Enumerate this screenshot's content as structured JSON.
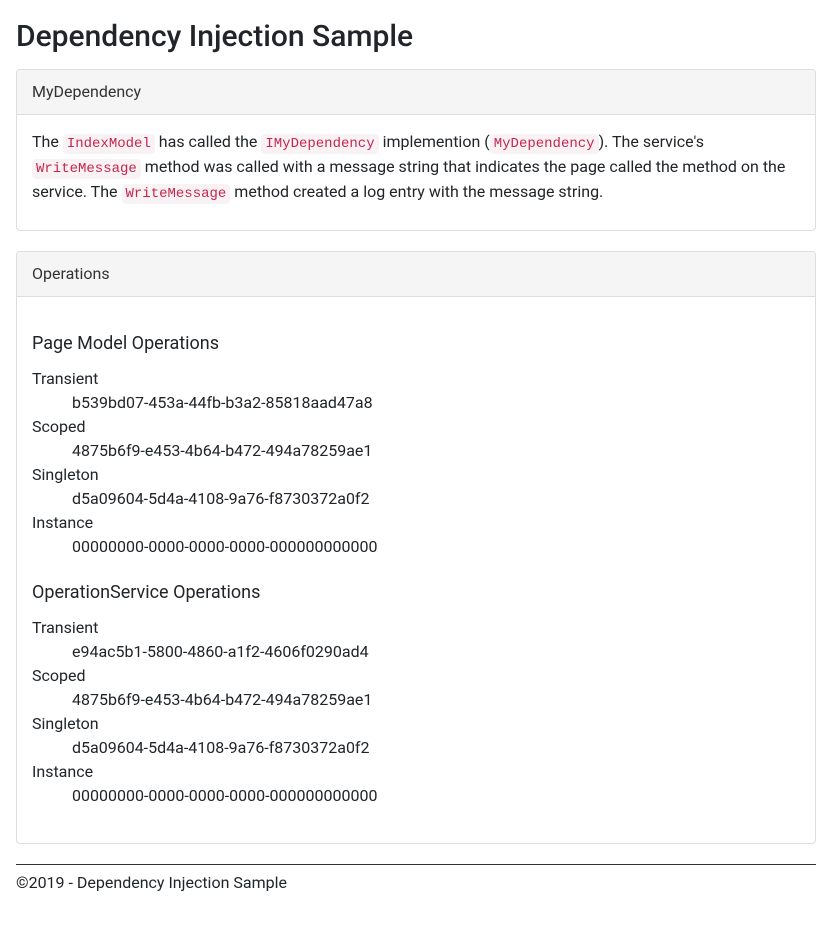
{
  "page_title": "Dependency Injection Sample",
  "panel1": {
    "heading": "MyDependency",
    "text_parts": {
      "t1": "The ",
      "c1": "IndexModel",
      "t2": " has called the ",
      "c2": "IMyDependency",
      "t3": " implemention (",
      "c3": "MyDependency",
      "t4": "). The service's ",
      "c4": "WriteMessage",
      "t5": " method was called with a message string that indicates the page called the method on the service. The ",
      "c5": "WriteMessage",
      "t6": " method created a log entry with the message string."
    }
  },
  "panel2": {
    "heading": "Operations",
    "page_model": {
      "title": "Page Model Operations",
      "labels": {
        "transient": "Transient",
        "scoped": "Scoped",
        "singleton": "Singleton",
        "instance": "Instance"
      },
      "values": {
        "transient": "b539bd07-453a-44fb-b3a2-85818aad47a8",
        "scoped": "4875b6f9-e453-4b64-b472-494a78259ae1",
        "singleton": "d5a09604-5d4a-4108-9a76-f8730372a0f2",
        "instance": "00000000-0000-0000-0000-000000000000"
      }
    },
    "operation_service": {
      "title": "OperationService Operations",
      "labels": {
        "transient": "Transient",
        "scoped": "Scoped",
        "singleton": "Singleton",
        "instance": "Instance"
      },
      "values": {
        "transient": "e94ac5b1-5800-4860-a1f2-4606f0290ad4",
        "scoped": "4875b6f9-e453-4b64-b472-494a78259ae1",
        "singleton": "d5a09604-5d4a-4108-9a76-f8730372a0f2",
        "instance": "00000000-0000-0000-0000-000000000000"
      }
    }
  },
  "footer": "©2019 - Dependency Injection Sample"
}
